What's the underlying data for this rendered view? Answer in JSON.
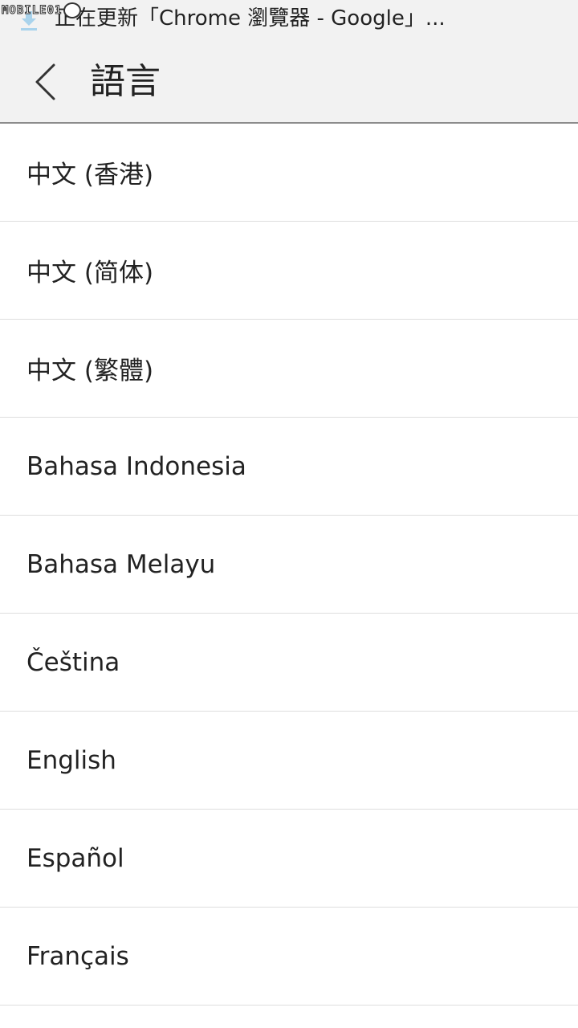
{
  "watermark": {
    "text": "MOBILE01"
  },
  "status_bar": {
    "icon": "download-icon",
    "notification_text": "正在更新「Chrome 瀏覽器 - Google」..."
  },
  "toolbar": {
    "back_icon": "chevron-left-icon",
    "title": "語言"
  },
  "languages": [
    "中文 (香港)",
    "中文 (简体)",
    "中文 (繁體)",
    "Bahasa Indonesia",
    "Bahasa Melayu",
    "Čeština",
    "English",
    "Español",
    "Français"
  ],
  "colors": {
    "header_bg": "#f2f2f2",
    "divider": "#dedede",
    "text": "#222222",
    "download_icon": "#a9d3ec"
  }
}
